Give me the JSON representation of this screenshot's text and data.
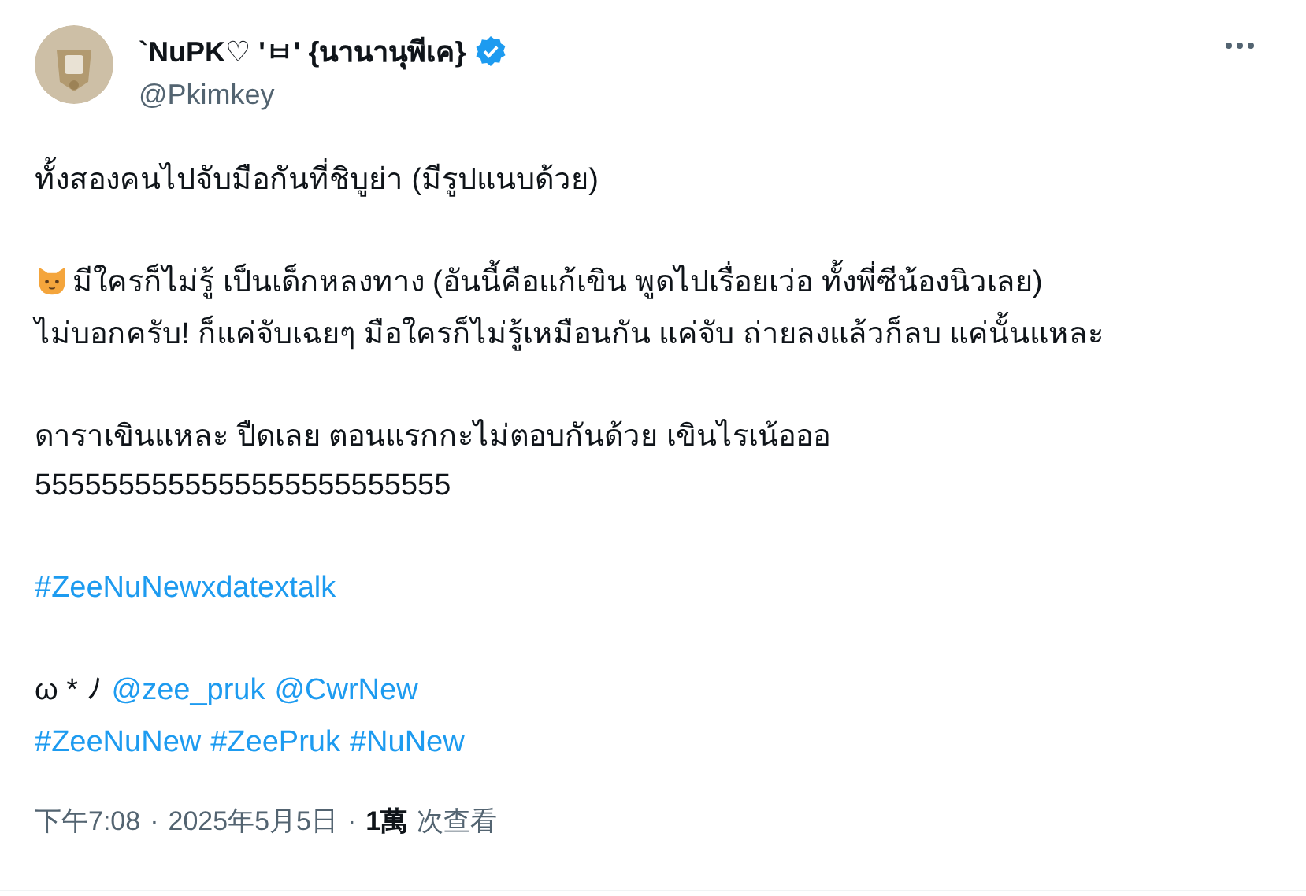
{
  "author": {
    "name": "`NuPK♡ 'ㅂ' {นานานุพีเค}",
    "handle": "@Pkimkey",
    "verified": true
  },
  "paragraphs": [
    [
      [
        {
          "kind": "text",
          "text": "ทั้งสองคนไปจับมือกันที่ชิบูย่า (มีรูปแนบด้วย)"
        }
      ]
    ],
    [
      [
        {
          "kind": "emoji"
        },
        {
          "kind": "text",
          "text": "มีใครก็ไม่รู้ เป็นเด็กหลงทาง (อันนี้คือแก้เขิน พูดไปเรื่อยเว่อ ทั้งพี่ซีน้องนิวเลย)"
        }
      ],
      [
        {
          "kind": "text",
          "text": "ไม่บอกครับ! ก็แค่จับเฉยๆ มือใครก็ไม่รู้เหมือนกัน แค่จับ ถ่ายลงแล้วก็ลบ แค่นั้นแหละ"
        }
      ]
    ],
    [
      [
        {
          "kind": "text",
          "text": "ดาราเขินแหละ ปืดเลย ตอนแรกกะไม่ตอบกันด้วย เขินไรเน้อออ"
        }
      ],
      [
        {
          "kind": "text",
          "text": "5555555555555555555555555"
        }
      ]
    ],
    [
      [
        {
          "kind": "hashtag",
          "text": "#ZeeNuNewxdatextalk"
        }
      ]
    ],
    [
      [
        {
          "kind": "text",
          "text": "ω * ﾉ"
        },
        {
          "kind": "mention",
          "text": "@zee_pruk"
        },
        {
          "kind": "mention",
          "text": "@CwrNew"
        }
      ],
      [
        {
          "kind": "hashtag",
          "text": "#ZeeNuNew"
        },
        {
          "kind": "hashtag",
          "text": "#ZeePruk"
        },
        {
          "kind": "hashtag",
          "text": "#NuNew"
        }
      ]
    ]
  ],
  "meta": {
    "time": "下午7:08",
    "separator_1": "·",
    "date": "2025年5月5日",
    "separator_2": "·",
    "views": "1萬",
    "views_label": "次查看"
  }
}
